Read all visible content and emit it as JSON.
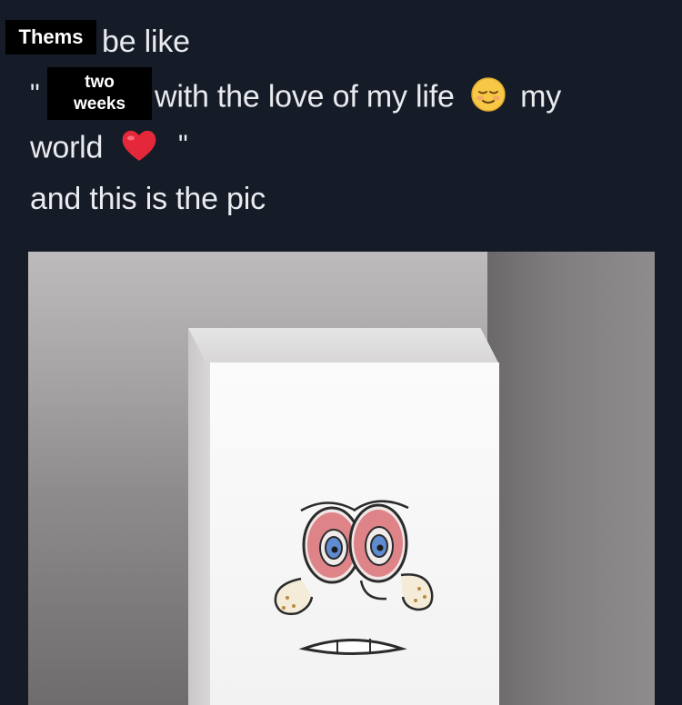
{
  "post": {
    "line1_text": "be like",
    "line2_quote_open": "\"",
    "line2_text": "with the love of my life",
    "line2_end": "my",
    "line3_text": "world",
    "line3_quote_close": "\"",
    "line4_text": "and this is the pic"
  },
  "stickers": {
    "top_label": "Thems",
    "middle_label_top": "two",
    "middle_label_bottom": "weeks"
  },
  "icons": {
    "relieved_face": "relieved-face-emoji",
    "red_heart": "red-heart-emoji"
  },
  "colors": {
    "background": "#161b28",
    "text": "#e9ebef",
    "heart": "#e4283a",
    "emoji_face": "#f7c845"
  }
}
